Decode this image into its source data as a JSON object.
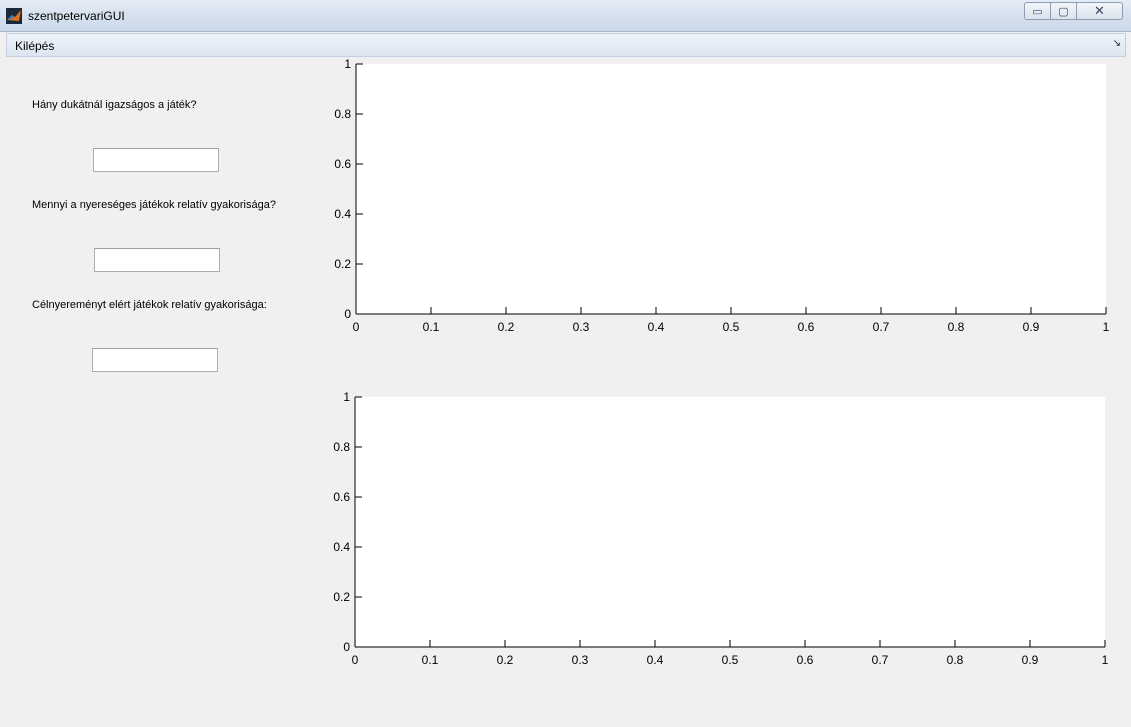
{
  "window": {
    "title": "szentpetervariGUI",
    "minimize_glyph": "▭",
    "maximize_glyph": "▢",
    "close_glyph": "✕"
  },
  "menu": {
    "items": [
      {
        "label": "Kilépés"
      }
    ],
    "overflow_glyph": "↘"
  },
  "panel": {
    "questions": [
      {
        "label": "Hány dukátnál igazságos a játék?",
        "value": ""
      },
      {
        "label": "Mennyi a nyereséges játékok relatív gyakorisága?",
        "value": ""
      },
      {
        "label": "Célnyereményt elért játékok relatív gyakorisága:",
        "value": ""
      }
    ]
  },
  "colors": {
    "axes_background": "#ffffff",
    "figure_background": "#f0f0f0",
    "axis_color": "#000000"
  },
  "chart_data": [
    {
      "type": "line",
      "series": [],
      "xlim": [
        0,
        1
      ],
      "ylim": [
        0,
        1
      ],
      "x_ticks": [
        "0",
        "0.1",
        "0.2",
        "0.3",
        "0.4",
        "0.5",
        "0.6",
        "0.7",
        "0.8",
        "0.9",
        "1"
      ],
      "y_ticks": [
        "0",
        "0.2",
        "0.4",
        "0.6",
        "0.8",
        "1"
      ],
      "grid": false
    },
    {
      "type": "line",
      "series": [],
      "xlim": [
        0,
        1
      ],
      "ylim": [
        0,
        1
      ],
      "x_ticks": [
        "0",
        "0.1",
        "0.2",
        "0.3",
        "0.4",
        "0.5",
        "0.6",
        "0.7",
        "0.8",
        "0.9",
        "1"
      ],
      "y_ticks": [
        "0",
        "0.2",
        "0.4",
        "0.6",
        "0.8",
        "1"
      ],
      "grid": false
    }
  ]
}
